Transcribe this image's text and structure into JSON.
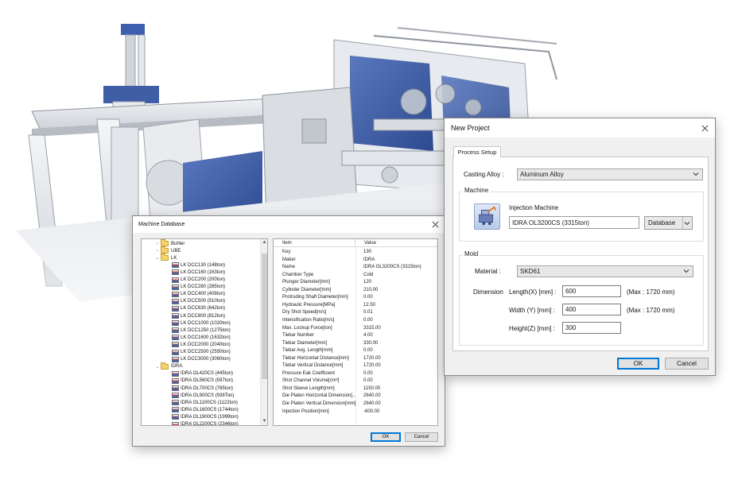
{
  "colors": {
    "accent": "#0078d7",
    "machine_blue": "#3f5ea6",
    "machine_white": "#e9ebee"
  },
  "machine_database": {
    "title": "Machine Database",
    "tree": [
      {
        "label": "Buhler",
        "type": "folder",
        "expanded": false
      },
      {
        "label": "UBE",
        "type": "folder",
        "expanded": false
      },
      {
        "label": "LK",
        "type": "folder",
        "expanded": true
      },
      {
        "label": "LK DCC130 (148ton)",
        "type": "machine"
      },
      {
        "label": "LK DCC160 (163ton)",
        "type": "machine"
      },
      {
        "label": "LK DCC200 (200ton)",
        "type": "machine"
      },
      {
        "label": "LK DCC280 (285ton)",
        "type": "machine"
      },
      {
        "label": "LK DCC400 (408ton)",
        "type": "machine"
      },
      {
        "label": "LK DCC500 (510ton)",
        "type": "machine"
      },
      {
        "label": "LK DCC630 (642ton)",
        "type": "machine"
      },
      {
        "label": "LK DCC800 (812ton)",
        "type": "machine"
      },
      {
        "label": "LK DCC1000 (1020ton)",
        "type": "machine"
      },
      {
        "label": "LK DCC1250 (1275ton)",
        "type": "machine"
      },
      {
        "label": "LK DCC1600 (1632ton)",
        "type": "machine"
      },
      {
        "label": "LK DCC2000 (2040ton)",
        "type": "machine"
      },
      {
        "label": "LK DCC2500 (2550ton)",
        "type": "machine"
      },
      {
        "label": "LK DCC3000 (3060ton)",
        "type": "machine"
      },
      {
        "label": "IDRA",
        "type": "folder",
        "expanded": true
      },
      {
        "label": "IDRA OL420CS (445ton)",
        "type": "machine"
      },
      {
        "label": "IDRA OL560CS (597ton)",
        "type": "machine"
      },
      {
        "label": "IDRA OL700CS (765ton)",
        "type": "machine"
      },
      {
        "label": "IDRA OL900CS (938Ton)",
        "type": "machine"
      },
      {
        "label": "IDRA OL1100CS (1122ton)",
        "type": "machine"
      },
      {
        "label": "IDRA OL1600CS (1744ton)",
        "type": "machine"
      },
      {
        "label": "IDRA OL1900CS (1999ton)",
        "type": "machine"
      },
      {
        "label": "IDRA OL2200CS (2346ton)",
        "type": "machine"
      }
    ],
    "grid_headers": {
      "item": "Item",
      "value": "Value"
    },
    "properties": [
      {
        "item": "Key",
        "value": "130"
      },
      {
        "item": "Maker",
        "value": "IDRA"
      },
      {
        "item": "Name",
        "value": "IDRA OL3200CS (3315ton)"
      },
      {
        "item": "Chamber Type",
        "value": "Cold"
      },
      {
        "item": "Plunger Diameter[mm]",
        "value": "120"
      },
      {
        "item": "Cylinder Diameter[mm]",
        "value": "210.00"
      },
      {
        "item": "Protruding Shaft Diameter[mm]",
        "value": "0.00"
      },
      {
        "item": "Hydraulic Pressure[MPa]",
        "value": "12.50"
      },
      {
        "item": "Dry Shot Speed[m/s]",
        "value": "0.01"
      },
      {
        "item": "Intensification Ratio[m/s]",
        "value": "0.00"
      },
      {
        "item": "Max. Lockup Force[ton]",
        "value": "3315.00"
      },
      {
        "item": "Tiebar Number",
        "value": "4.00"
      },
      {
        "item": "Tiebar Diameter[mm]",
        "value": "330.00"
      },
      {
        "item": "Tiebar Avg. Length[mm]",
        "value": "0.00"
      },
      {
        "item": "Tiebar Horizontal Distance[mm]",
        "value": "1720.00"
      },
      {
        "item": "Tiebar Vertical Distance[mm]",
        "value": "1720.00"
      },
      {
        "item": "Pressure Eak Coefficient",
        "value": "0.00"
      },
      {
        "item": "Shot Channel Volume[cm³]",
        "value": "0.00"
      },
      {
        "item": "Shot Sleeve Length[mm]",
        "value": "1150.00"
      },
      {
        "item": "Die Platen Horizontal Dimension[...",
        "value": "2640.00"
      },
      {
        "item": "Die Platen Vertical Dimension[mm]",
        "value": "2640.00"
      },
      {
        "item": "Injection Position[mm]",
        "value": "-600.00"
      }
    ],
    "ok_label": "OK",
    "cancel_label": "Cancel"
  },
  "new_project": {
    "title": "New Project",
    "tab_label": "Process Setup",
    "casting_alloy_label": "Casting Alloy :",
    "casting_alloy_value": "Aluminum Alloy",
    "machine_group_label": "Machine",
    "injection_machine_label": "Injection Machine",
    "injection_machine_value": "IDRA OL3200CS (3315ton)",
    "database_label": "Database",
    "mold_group_label": "Mold",
    "material_label": "Material :",
    "material_value": "SKD61",
    "dimension_label": "Dimension",
    "length_label": "Length(X) [mm] :",
    "length_value": "600",
    "length_max": "(Max : 1720 mm)",
    "width_label": "Width (Y) [mm] :",
    "width_value": "400",
    "width_max": "(Max : 1720 mm)",
    "height_label": "Height(Z) [mm] :",
    "height_value": "300",
    "ok_label": "OK",
    "cancel_label": "Cancel"
  }
}
